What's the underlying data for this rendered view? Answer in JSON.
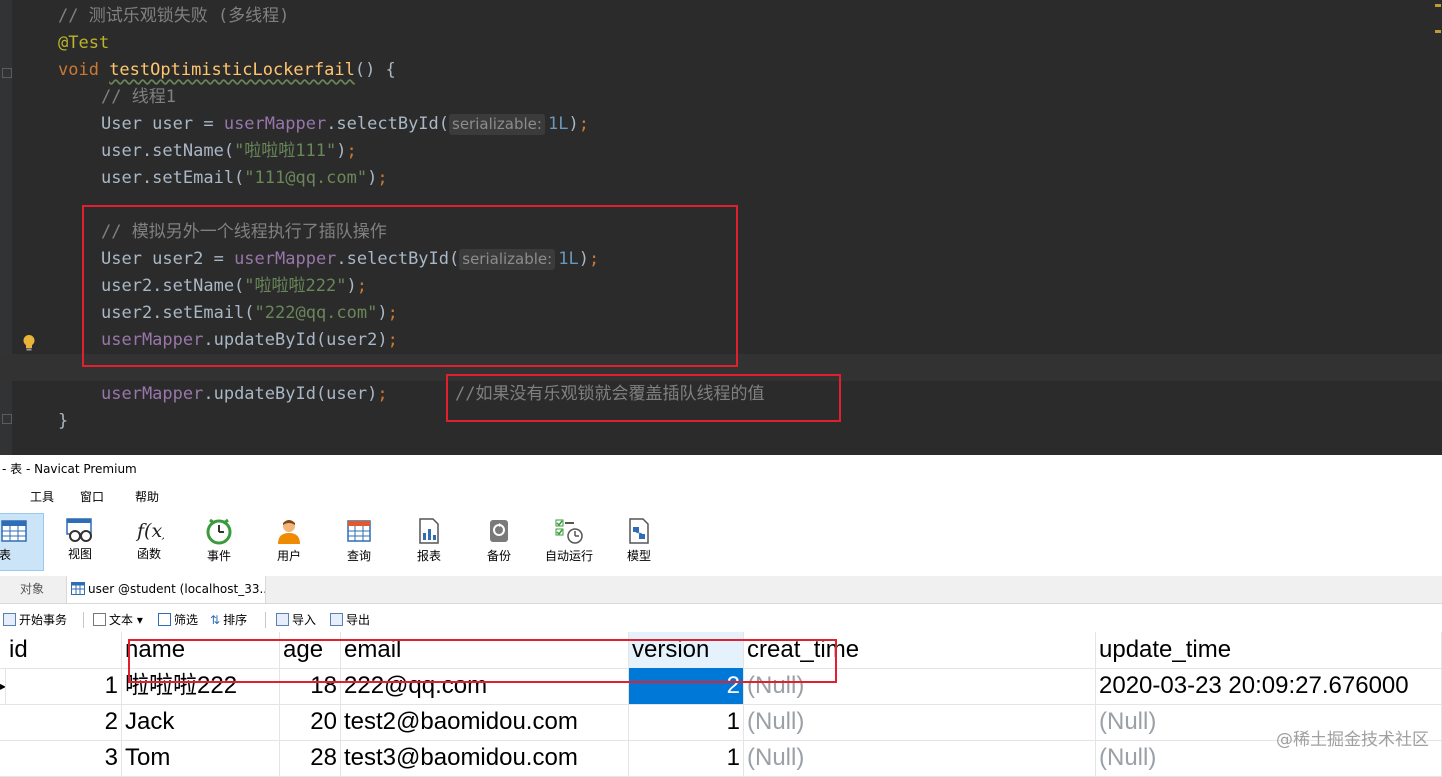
{
  "editor": {
    "lines": [
      {
        "segments": [
          {
            "c": "cm",
            "t": "// 测试乐观锁失败 (多线程)"
          }
        ]
      },
      {
        "segments": [
          {
            "c": "an",
            "t": "@Test"
          }
        ]
      },
      {
        "segments": [
          {
            "c": "kw",
            "t": "void "
          },
          {
            "c": "fn",
            "t": "testOptimisticLockerfail"
          },
          {
            "c": "",
            "t": "() {"
          }
        ]
      },
      {
        "segments": [
          {
            "c": "cm",
            "t": "// 线程1"
          }
        ]
      },
      {
        "segments": [
          {
            "c": "",
            "t": "User user = "
          },
          {
            "c": "fld",
            "t": "userMapper"
          },
          {
            "c": "",
            "t": ".selectById("
          },
          {
            "c": "hint",
            "t": "serializable:"
          },
          {
            "c": "num",
            "t": "1L"
          },
          {
            "c": "",
            "t": ")"
          },
          {
            "c": "kw",
            "t": ";"
          }
        ]
      },
      {
        "segments": [
          {
            "c": "",
            "t": "user.setName("
          },
          {
            "c": "str",
            "t": "\"啦啦啦111\""
          },
          {
            "c": "",
            "t": ")"
          },
          {
            "c": "kw",
            "t": ";"
          }
        ]
      },
      {
        "segments": [
          {
            "c": "",
            "t": "user.setEmail("
          },
          {
            "c": "str",
            "t": "\"111@qq.com\""
          },
          {
            "c": "",
            "t": ")"
          },
          {
            "c": "kw",
            "t": ";"
          }
        ]
      },
      {
        "segments": []
      },
      {
        "segments": [
          {
            "c": "cm",
            "t": "// 模拟另外一个线程执行了插队操作"
          }
        ]
      },
      {
        "segments": [
          {
            "c": "",
            "t": "User user2 = "
          },
          {
            "c": "fld",
            "t": "userMapper"
          },
          {
            "c": "",
            "t": ".selectById("
          },
          {
            "c": "hint",
            "t": "serializable:"
          },
          {
            "c": "num",
            "t": "1L"
          },
          {
            "c": "",
            "t": ")"
          },
          {
            "c": "kw",
            "t": ";"
          }
        ]
      },
      {
        "segments": [
          {
            "c": "",
            "t": "user2.setName("
          },
          {
            "c": "str",
            "t": "\"啦啦啦222\""
          },
          {
            "c": "",
            "t": ")"
          },
          {
            "c": "kw",
            "t": ";"
          }
        ]
      },
      {
        "segments": [
          {
            "c": "",
            "t": "user2.setEmail("
          },
          {
            "c": "str",
            "t": "\"222@qq.com\""
          },
          {
            "c": "",
            "t": ")"
          },
          {
            "c": "kw",
            "t": ";"
          }
        ]
      },
      {
        "segments": [
          {
            "c": "fld",
            "t": "userMapper"
          },
          {
            "c": "",
            "t": ".updateById(user2)"
          },
          {
            "c": "kw",
            "t": ";"
          }
        ]
      },
      {
        "segments": []
      },
      {
        "segments": [
          {
            "c": "fld",
            "t": "userMapper"
          },
          {
            "c": "",
            "t": ".updateById(user)"
          },
          {
            "c": "kw",
            "t": ";"
          }
        ]
      },
      {
        "segments": [
          {
            "c": "",
            "t": "}"
          }
        ]
      }
    ],
    "inline_comment": "//如果没有乐观锁就会覆盖插队线程的值"
  },
  "navicat": {
    "window_title": "- 表 - Navicat Premium",
    "menus": [
      "工具",
      "窗口",
      "帮助"
    ],
    "toolbar": [
      {
        "label": "表",
        "icon": "table-icon"
      },
      {
        "label": "视图",
        "icon": "view-icon"
      },
      {
        "label": "函数",
        "icon": "function-icon"
      },
      {
        "label": "事件",
        "icon": "event-clock-icon"
      },
      {
        "label": "用户",
        "icon": "user-icon"
      },
      {
        "label": "查询",
        "icon": "query-icon"
      },
      {
        "label": "报表",
        "icon": "report-icon"
      },
      {
        "label": "备份",
        "icon": "backup-icon"
      },
      {
        "label": "自动运行",
        "icon": "autorun-icon"
      },
      {
        "label": "模型",
        "icon": "model-icon"
      }
    ],
    "tabs": {
      "objects": "对象",
      "user": "user @student (localhost_33..."
    },
    "subtoolbar": {
      "begin_transaction": "开始事务",
      "text": "文本",
      "filter": "筛选",
      "sort": "排序",
      "import": "导入",
      "export": "导出"
    },
    "grid": {
      "columns": [
        "id",
        "name",
        "age",
        "email",
        "version",
        "creat_time",
        "update_time"
      ],
      "rows": [
        [
          "1",
          "啦啦啦222",
          "18",
          "222@qq.com",
          "2",
          "(Null)",
          "2020-03-23 20:09:27.676000"
        ],
        [
          "2",
          "Jack",
          "20",
          "test2@baomidou.com",
          "1",
          "(Null)",
          "(Null)"
        ],
        [
          "3",
          "Tom",
          "28",
          "test3@baomidou.com",
          "1",
          "(Null)",
          "(Null)"
        ]
      ]
    },
    "watermark": "@稀土掘金技术社区"
  }
}
